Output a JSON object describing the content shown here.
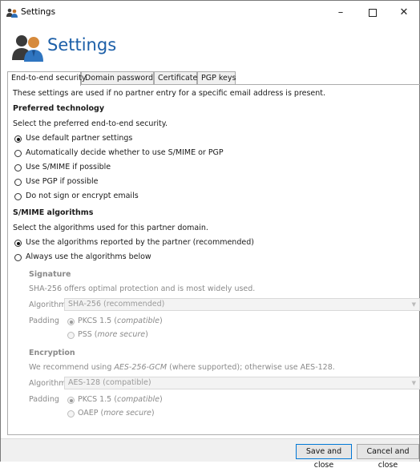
{
  "window": {
    "title": "Settings",
    "icon": "users-icon",
    "minimize_glyph": "–",
    "close_glyph": "✕"
  },
  "header": {
    "title": "Settings",
    "icon": "users-settings-icon"
  },
  "tabs": [
    {
      "label": "End-to-end security",
      "active": true
    },
    {
      "label": "Domain password",
      "active": false
    },
    {
      "label": "Certificates",
      "active": false
    },
    {
      "label": "PGP keys",
      "active": false
    }
  ],
  "content": {
    "intro": "These settings are used if no partner entry for a specific email address is present.",
    "preferred": {
      "heading": "Preferred technology",
      "description": "Select the preferred end-to-end security.",
      "options": [
        {
          "label": "Use default partner settings",
          "checked": true
        },
        {
          "label": "Automatically decide whether to use S/MIME or PGP",
          "checked": false
        },
        {
          "label": "Use S/MIME if possible",
          "checked": false
        },
        {
          "label": "Use PGP if possible",
          "checked": false
        },
        {
          "label": "Do not sign or encrypt emails",
          "checked": false
        }
      ]
    },
    "smime": {
      "heading": "S/MIME algorithms",
      "description": "Select the algorithms used for this partner domain.",
      "options": [
        {
          "label": "Use the algorithms reported by the partner (recommended)",
          "checked": true
        },
        {
          "label": "Always use the algorithms below",
          "checked": false
        }
      ]
    },
    "signature": {
      "heading": "Signature",
      "description": "SHA-256 offers optimal protection and is most widely used.",
      "algorithm_label": "Algorithm",
      "algorithm_value": "SHA-256 (recommended)",
      "padding_label": "Padding",
      "padding_options": [
        {
          "label": "PKCS 1.5 (",
          "emph": "compatible",
          "suffix": ")",
          "checked": true
        },
        {
          "label": "PSS (",
          "emph": "more secure",
          "suffix": ")",
          "checked": false
        }
      ]
    },
    "encryption": {
      "heading": "Encryption",
      "description_prefix": "We recommend using ",
      "description_emph": "AES-256-GCM",
      "description_suffix": " (where supported); otherwise use AES-128.",
      "algorithm_label": "Algorithm",
      "algorithm_value": "AES-128 (compatible)",
      "padding_label": "Padding",
      "padding_options": [
        {
          "label": "PKCS 1.5 (",
          "emph": "compatible",
          "suffix": ")",
          "checked": true
        },
        {
          "label": "OAEP (",
          "emph": "more secure",
          "suffix": ")",
          "checked": false
        }
      ]
    }
  },
  "footer": {
    "save_label": "Save and close",
    "cancel_label": "Cancel and close"
  }
}
